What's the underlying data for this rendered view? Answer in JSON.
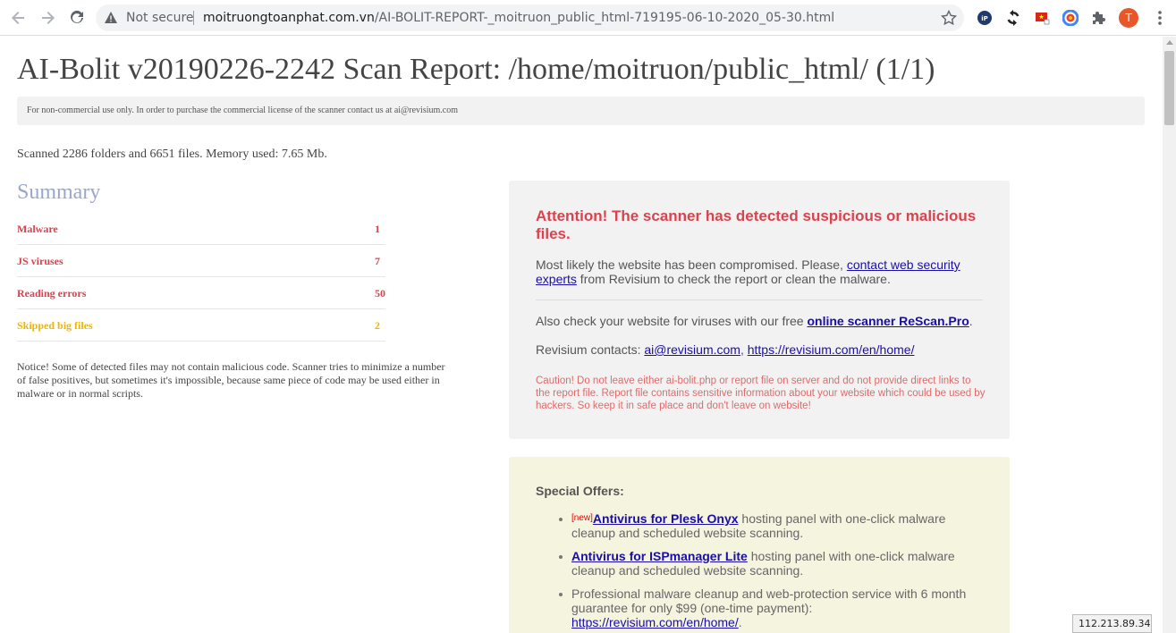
{
  "browser": {
    "security_label": "Not secure",
    "url_host": "moitruongtoanphat.com.vn",
    "url_path": "/AI-BOLIT-REPORT-_moitruon_public_html-719195-06-10-2020_05-30.html",
    "profile_initial": "T"
  },
  "report": {
    "title": "AI-Bolit v20190226-2242 Scan Report: /home/moitruon/public_html/ (1/1)",
    "license_note": "For non-commercial use only. In order to purchase the commercial license of the scanner contact us at ai@revisium.com",
    "scanned_text": "Scanned 2286 folders and 6651 files. Memory used: 7.65 Mb."
  },
  "summary": {
    "title": "Summary",
    "rows": [
      {
        "label": "Malware",
        "value": "1"
      },
      {
        "label": "JS viruses",
        "value": "7"
      },
      {
        "label": "Reading errors",
        "value": "50"
      },
      {
        "label": "Skipped big files",
        "value": "2"
      }
    ],
    "notice": "Notice! Some of detected files may not contain malicious code. Scanner tries to minimize a number of false positives, but sometimes it's impossible, because same piece of code may be used either in malware or in normal scripts."
  },
  "alert": {
    "heading": "Attention! The scanner has detected suspicious or malicious files.",
    "p1_before": "Most likely the website has been compromised. Please, ",
    "p1_link": "contact web security experts",
    "p1_after": " from Revisium to check the report or clean the malware.",
    "p2_before": "Also check your website for viruses with our free ",
    "p2_link": "online scanner ReScan.Pro",
    "p2_after": ".",
    "p3_before": "Revisium contacts: ",
    "p3_email": "ai@revisium.com",
    "p3_sep": ", ",
    "p3_site": "https://revisium.com/en/home/",
    "caution": "Caution! Do not leave either ai-bolit.php or report file on server and do not provide direct links to the report file. Report file contains sensitive information about your website which could be used by hackers. So keep it in safe place and don't leave on website!"
  },
  "offers": {
    "title": "Special Offers:",
    "new_tag": "[new]",
    "item1_link": "Antivirus for Plesk Onyx",
    "item1_text": " hosting panel with one-click malware cleanup and scheduled website scanning.",
    "item2_link": "Antivirus for ISPmanager Lite",
    "item2_text": " hosting panel with one-click malware cleanup and scheduled website scanning.",
    "item3_text": "Professional malware cleanup and web-protection service with 6 month guarantee for only $99 (one-time payment): ",
    "item3_link": "https://revisium.com/en/home/",
    "item3_after": "."
  },
  "ip_badge": "112.213.89.34",
  "colors": {
    "danger": "#d9434f",
    "warning": "#f0b400",
    "summary_title": "#9aa6cc",
    "link": "#1a0dab"
  }
}
